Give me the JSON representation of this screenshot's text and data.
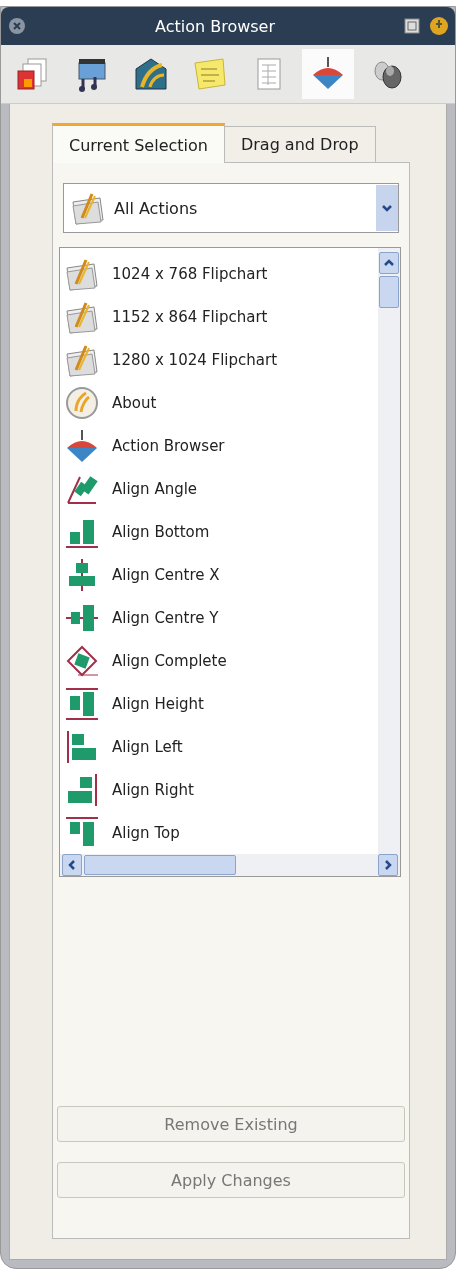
{
  "window": {
    "title": "Action Browser"
  },
  "toolbar": [
    {
      "kind": "pages",
      "selected": false
    },
    {
      "kind": "film",
      "selected": false
    },
    {
      "kind": "picture",
      "selected": false
    },
    {
      "kind": "note",
      "selected": false
    },
    {
      "kind": "document",
      "selected": false
    },
    {
      "kind": "top",
      "selected": true
    },
    {
      "kind": "mouse",
      "selected": false
    }
  ],
  "tabs": [
    {
      "label": "Current Selection",
      "selected": true
    },
    {
      "label": "Drag and Drop",
      "selected": false
    }
  ],
  "filter": {
    "value": "All Actions"
  },
  "actions": [
    {
      "kind": "flipchart",
      "label": "1024 x 768 Flipchart"
    },
    {
      "kind": "flipchart",
      "label": "1152 x 864 Flipchart"
    },
    {
      "kind": "flipchart",
      "label": "1280 x 1024 Flipchart"
    },
    {
      "kind": "about",
      "label": "About"
    },
    {
      "kind": "top",
      "label": "Action Browser"
    },
    {
      "kind": "angle",
      "label": "Align Angle"
    },
    {
      "kind": "bottom",
      "label": "Align Bottom"
    },
    {
      "kind": "centre-x",
      "label": "Align Centre X"
    },
    {
      "kind": "centre-y",
      "label": "Align Centre Y"
    },
    {
      "kind": "complete",
      "label": "Align Complete"
    },
    {
      "kind": "height",
      "label": "Align Height"
    },
    {
      "kind": "left",
      "label": "Align Left"
    },
    {
      "kind": "right",
      "label": "Align Right"
    },
    {
      "kind": "top-align",
      "label": "Align Top"
    }
  ],
  "buttons": [
    {
      "label": "Remove Existing",
      "disabled": true
    },
    {
      "label": "Apply Changes",
      "disabled": true
    }
  ]
}
